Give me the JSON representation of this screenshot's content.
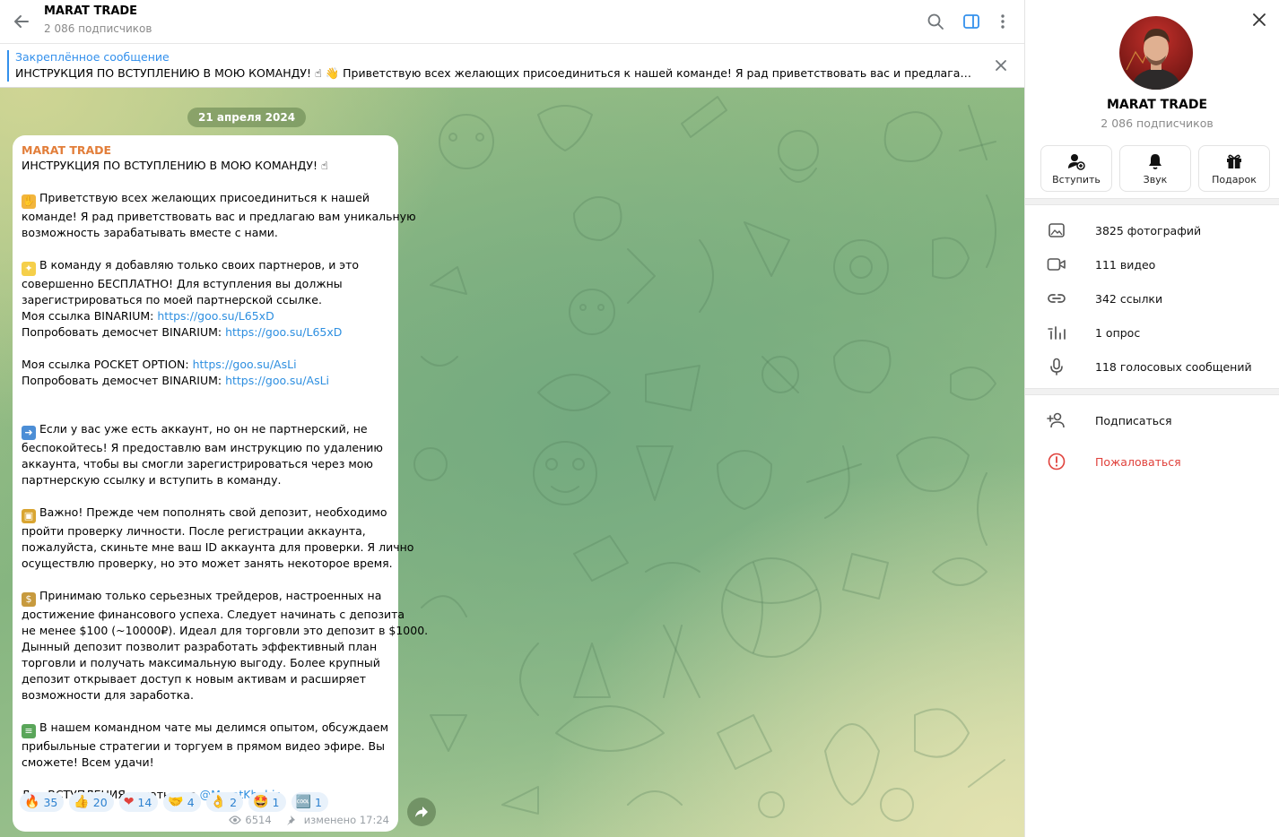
{
  "header": {
    "title": "MARAT TRADE",
    "subtitle": "2 086 подписчиков"
  },
  "pinned": {
    "title": "Закреплённое сообщение",
    "text": "ИНСТРУКЦИЯ ПО ВСТУПЛЕНИЮ В МОЮ КОМАНДУ! ☝ 👋 Приветствую всех желающих присоединиться к нашей команде! Я рад приветствовать вас и предлагаю вам ..."
  },
  "chat": {
    "date": "21 апреля 2024",
    "message": {
      "author": "MARAT TRADE",
      "lines": {
        "l1": "ИНСТРУКЦИЯ ПО ВСТУПЛЕНИЮ В МОЮ КОМАНДУ! ☝",
        "l2": "Приветствую всех желающих присоединиться к нашей",
        "l3": "команде! Я рад приветствовать вас и предлагаю вам уникальную",
        "l4": "возможность зарабатывать вместе с нами.",
        "l5": "В команду я добавляю только своих партнеров, и это",
        "l6": "совершенно БЕСПЛАТНО! Для вступления вы должны",
        "l7": "зарегистрироваться по моей партнерской ссылке.",
        "l8a": "Моя ссылка BINARIUM: ",
        "l8b": "https://goo.su/L65xD",
        "l9a": "Попробовать демосчет BINARIUM: ",
        "l9b": "https://goo.su/L65xD",
        "l10a": "Моя ссылка POCKET OPTION: ",
        "l10b": "https://goo.su/AsLi",
        "l11a": "Попробовать демосчет BINARIUM: ",
        "l11b": "https://goo.su/AsLi",
        "l12": "Если у вас уже есть аккаунт, но он не партнерский, не",
        "l13": "беспокойтесь! Я предоставлю вам инструкцию по удалению",
        "l14": "аккаунта, чтобы вы смогли зарегистрироваться через мою",
        "l15": "партнерскую ссылку и вступить в команду.",
        "l16": "Важно! Прежде чем пополнять свой депозит, необходимо",
        "l17": "пройти проверку личности. После регистрации аккаунта,",
        "l18": "пожалуйста, скиньте мне ваш ID аккаунта для проверки. Я лично",
        "l19": "осуществлю проверку, но это может занять некоторое время.",
        "l20": "Принимаю только серьезных трейдеров, настроенных на",
        "l21": "достижение финансового успеха. Следует начинать с депозита",
        "l22": "не менее $100 (~10000₽). Идеал для торговли это депозит в $1000.",
        "l23": "Дынный депозит позволит разработать эффективный план",
        "l24": "торговли и получать максимальную выгоду. Более крупный",
        "l25": "депозит открывает доступ к новым активам и расширяет",
        "l26": "возможности для заработка.",
        "l27": "В нашем командном чате мы делимся опытом, обсуждаем",
        "l28": "прибыльные стратегии и торгуем в прямом видео эфире. Вы",
        "l29": "сможете! Всем удачи!",
        "l30a": "Для ВСТУПЛЕНИЯ писать мне ",
        "l30b": "@MaratKhabir",
        "l30c": "."
      },
      "reactions": [
        {
          "glyph": "🔥",
          "count": "35"
        },
        {
          "glyph": "👍",
          "count": "20"
        },
        {
          "glyph": "❤",
          "count": "14"
        },
        {
          "glyph": "🤝",
          "count": "4"
        },
        {
          "glyph": "👌",
          "count": "2"
        },
        {
          "glyph": "🤩",
          "count": "1"
        },
        {
          "glyph": "🆒",
          "count": "1"
        }
      ],
      "views": "6514",
      "edited": "изменено 17:24"
    }
  },
  "sidebar": {
    "name": "MARAT TRADE",
    "subtitle": "2 086 подписчиков",
    "actions": {
      "join": "Вступить",
      "sound": "Звук",
      "gift": "Подарок"
    },
    "media": {
      "photos": "3825 фотографий",
      "videos": "111 видео",
      "links": "342 ссылки",
      "polls": "1 опрос",
      "voice": "118 голосовых сообщений"
    },
    "subscribe": "Подписаться",
    "report": "Пожаловаться"
  },
  "colors": {
    "accent": "#3390ec",
    "author": "#e27e3a",
    "link": "#2e8fe0",
    "danger": "#e0413b"
  }
}
